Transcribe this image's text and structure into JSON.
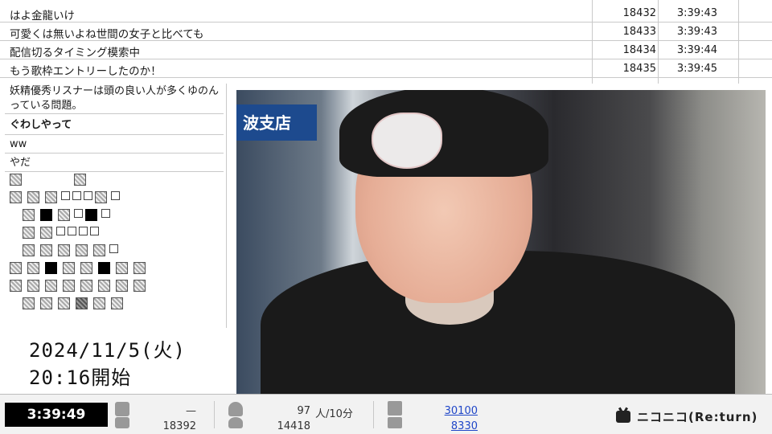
{
  "comments": [
    {
      "text": "はよ金龍いけ",
      "no": "18432",
      "time": "3:39:43"
    },
    {
      "text": "可愛くは無いよね世間の女子と比べても",
      "no": "18433",
      "time": "3:39:43"
    },
    {
      "text": "配信切るタイミング模索中",
      "no": "18434",
      "time": "3:39:44"
    },
    {
      "text": "もう歌枠エントリーしたのか！",
      "no": "18435",
      "time": "3:39:45"
    }
  ],
  "side_comments": {
    "c1_line1": "妖精優秀リスナーは頭の良い人が多くゆのん",
    "c1_line2": "っている問題。",
    "c2": "ぐわしやって",
    "c3": "ww",
    "c4": "やだ"
  },
  "video": {
    "sign_text": "波支店"
  },
  "broadcast": {
    "date": "2024/11/5(火)",
    "start": "20:16開始"
  },
  "stats": {
    "elapsed": "3:39:49",
    "comment_dash": "—",
    "comments_total": "18392",
    "viewers_rate": "97",
    "viewers_unit": "人/10分",
    "viewers_total": "14418",
    "ad_points": "30100",
    "gift_points": "8330"
  },
  "brand": {
    "logo_text": "ニコニコ(Re:turn)"
  },
  "icons": {
    "comment": "comment-bubble-icon",
    "viewer": "person-icon",
    "ad": "megaphone-icon",
    "gift": "gift-icon",
    "tv": "niconico-tv-icon"
  }
}
